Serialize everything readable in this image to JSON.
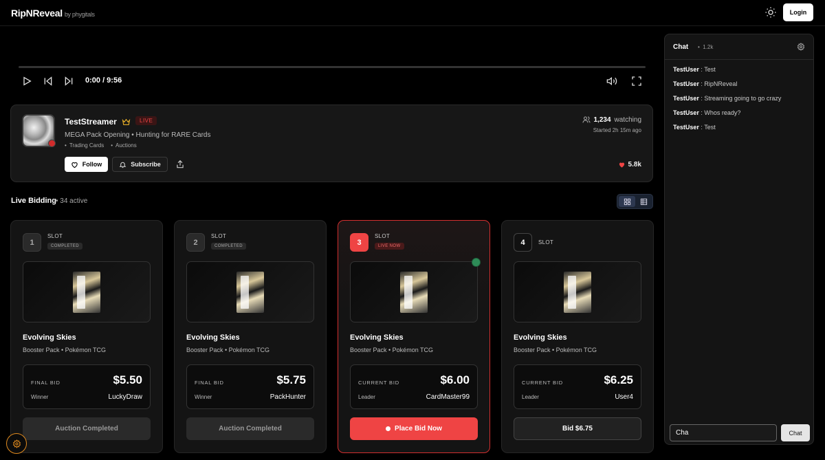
{
  "header": {
    "brand": "RipNReveal",
    "brand_sub": "by phygitals",
    "login_label": "Login"
  },
  "player": {
    "time": "0:00 / 9:56",
    "progress": 0
  },
  "streamer": {
    "name": "TestStreamer",
    "live_label": "LIVE",
    "subtitle": "MEGA Pack Opening • Hunting for RARE Cards",
    "tags": [
      "Trading Cards",
      "Auctions"
    ],
    "follow_label": "Follow",
    "subscribe_label": "Subscribe",
    "watching_count": "1,234",
    "watching_label": "watching",
    "started": "Started 2h 15m ago",
    "likes": "5.8k"
  },
  "bidding": {
    "title": "Live Bidding",
    "active": "34 active"
  },
  "cards": [
    {
      "num": "1",
      "slot": "SLOT",
      "status": "COMPLETED",
      "title": "Evolving Skies",
      "sub": "Booster Pack • Pokémon TCG",
      "bid_label": "FINAL BID",
      "amount": "$5.50",
      "who_label": "Winner",
      "who": "LuckyDraw",
      "action": "Auction Completed"
    },
    {
      "num": "2",
      "slot": "SLOT",
      "status": "COMPLETED",
      "title": "Evolving Skies",
      "sub": "Booster Pack • Pokémon TCG",
      "bid_label": "FINAL BID",
      "amount": "$5.75",
      "who_label": "Winner",
      "who": "PackHunter",
      "action": "Auction Completed"
    },
    {
      "num": "3",
      "slot": "SLOT",
      "status": "LIVE NOW",
      "title": "Evolving Skies",
      "sub": "Booster Pack • Pokémon TCG",
      "bid_label": "CURRENT BID",
      "amount": "$6.00",
      "who_label": "Leader",
      "who": "CardMaster99",
      "action": "Place Bid Now"
    },
    {
      "num": "4",
      "slot": "SLOT",
      "status": "",
      "title": "Evolving Skies",
      "sub": "Booster Pack • Pokémon TCG",
      "bid_label": "CURRENT BID",
      "amount": "$6.25",
      "who_label": "Leader",
      "who": "User4",
      "action": "Bid $6.75"
    }
  ],
  "chat": {
    "title": "Chat",
    "count": "1.2k",
    "messages": [
      {
        "user": "TestUser",
        "text": "Test"
      },
      {
        "user": "TestUser",
        "text": "RipNReveal"
      },
      {
        "user": "TestUser",
        "text": "Streaming going to go crazy"
      },
      {
        "user": "TestUser",
        "text": "Whos ready?"
      },
      {
        "user": "TestUser",
        "text": "Test"
      }
    ],
    "input_value": "Cha",
    "send_label": "Chat"
  },
  "colors": {
    "accent_red": "#ef4444",
    "live_border": "#d32f2f",
    "gold": "#f0b429",
    "settings_orange": "#e08a1e"
  }
}
